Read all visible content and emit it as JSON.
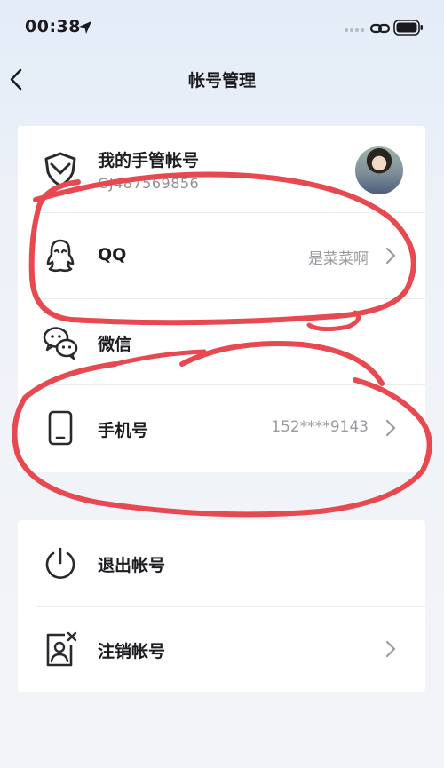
{
  "status_bar": {
    "time": "00:38"
  },
  "header": {
    "title": "帐号管理"
  },
  "accounts": {
    "main": {
      "label": "我的手管帐号",
      "id": "GJ487569856"
    },
    "qq": {
      "label": "QQ",
      "value": "是菜菜啊"
    },
    "wechat": {
      "label": "微信"
    },
    "phone": {
      "label": "手机号",
      "value": "152****9143"
    }
  },
  "actions": {
    "logout": {
      "label": "退出帐号"
    },
    "cancel": {
      "label": "注销帐号"
    }
  },
  "colors": {
    "annotation": "#e8484f",
    "chevron": "#9a9aa0",
    "icon": "#2a2a2e"
  }
}
